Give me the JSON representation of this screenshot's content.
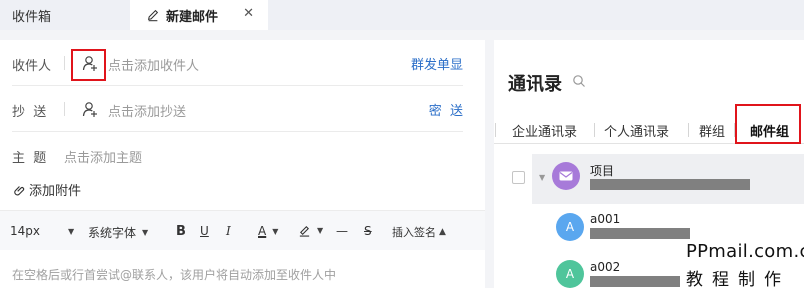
{
  "tabs": {
    "inbox": "收件箱",
    "compose": "新建邮件",
    "close": "✕"
  },
  "compose": {
    "to_label": "收件人",
    "to_placeholder": "点击添加收件人",
    "mass_send": "群发单显",
    "cc_label": "抄  送",
    "cc_placeholder": "点击添加抄送",
    "bcc": "密  送",
    "subject_label": "主  题",
    "subject_placeholder": "点击添加主题",
    "attach": "添加附件",
    "body_placeholder": "在空格后或行首尝试@联系人，该用户将自动添加至收件人中"
  },
  "toolbar": {
    "font_size": "14px",
    "font_family": "系统字体",
    "bold": "B",
    "underline": "U",
    "italic": "I",
    "font_color": "A",
    "line": "—",
    "strike": "S",
    "signature": "插入签名"
  },
  "contacts": {
    "title": "通讯录",
    "tabs": [
      "企业通讯录",
      "个人通讯录",
      "群组",
      "邮件组"
    ],
    "active_tab": "邮件组",
    "group_name": "项目",
    "members": [
      {
        "initial": "A",
        "name": "a001",
        "color": "#5aa7ef"
      },
      {
        "initial": "A",
        "name": "a002",
        "color": "#4fc59b"
      }
    ]
  },
  "watermark": {
    "line1": "PPmail.com.cn",
    "line2": "教程制作"
  },
  "colors": {
    "accent": "#2a6ec8",
    "highlight_box": "#e0141b",
    "group_avatar": "#a77ad9"
  }
}
